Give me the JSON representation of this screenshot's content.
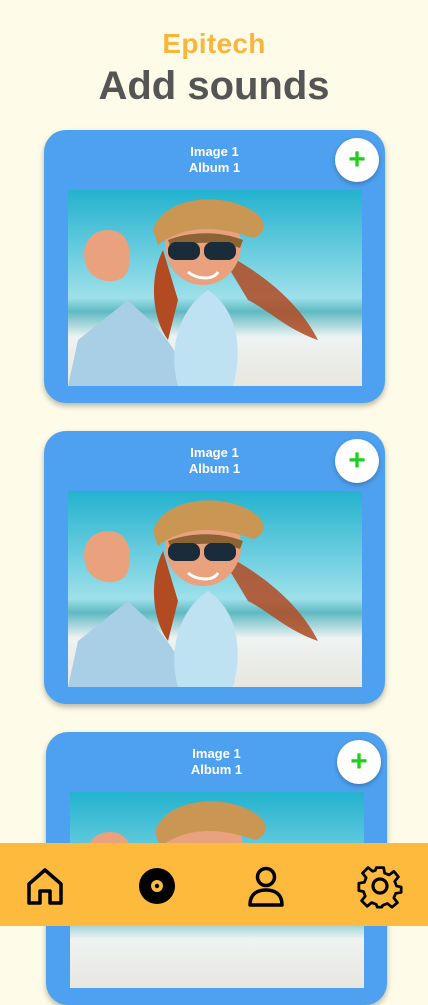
{
  "header": {
    "brand": "Epitech",
    "title": "Add sounds"
  },
  "cards": [
    {
      "image_label": "Image 1",
      "album_label": "Album 1",
      "add_label": "+"
    },
    {
      "image_label": "Image 1",
      "album_label": "Album 1",
      "add_label": "+"
    },
    {
      "image_label": "Image 1",
      "album_label": "Album 1",
      "add_label": "+"
    }
  ],
  "navbar": {
    "items": [
      {
        "icon": "home-icon"
      },
      {
        "icon": "vinyl-record-icon"
      },
      {
        "icon": "user-icon"
      },
      {
        "icon": "gear-icon"
      }
    ]
  },
  "colors": {
    "background": "#FEFBE8",
    "brand": "#F9B63C",
    "title": "#555555",
    "card": "#4EA0F0",
    "add_plus": "#1ECF1E",
    "navbar": "#FEBA3C"
  }
}
